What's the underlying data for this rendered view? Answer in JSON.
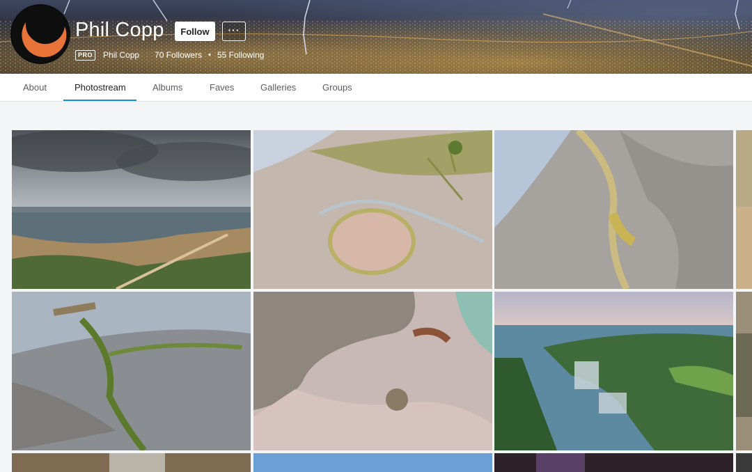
{
  "profile": {
    "name": "Phil Copp",
    "follow_label": "Follow",
    "more_label": "···",
    "pro_badge": "PRO",
    "username": "Phil Copp",
    "followers": "70 Followers",
    "separator": "•",
    "following": "55 Following"
  },
  "tabs": [
    {
      "label": "About",
      "active": false
    },
    {
      "label": "Photostream",
      "active": true
    },
    {
      "label": "Albums",
      "active": false
    },
    {
      "label": "Faves",
      "active": false
    },
    {
      "label": "Galleries",
      "active": false
    },
    {
      "label": "Groups",
      "active": false
    }
  ],
  "colors": {
    "accent_underline": "#128fdc",
    "page_background": "#f3f5f6",
    "tab_text": "#5b5d63"
  },
  "icons": {
    "avatar": "orange-crescent-moon-logo",
    "more": "ellipsis-icon"
  }
}
